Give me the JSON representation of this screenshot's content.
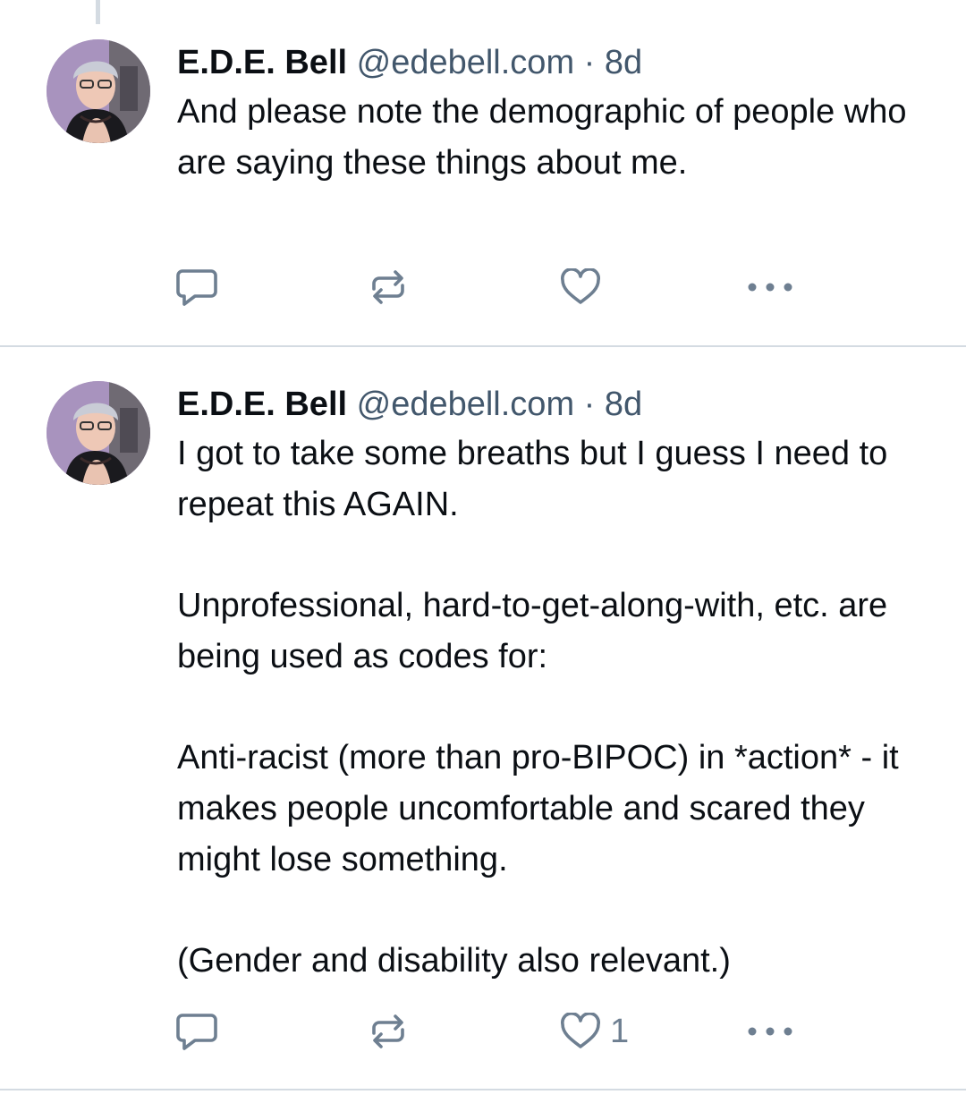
{
  "posts": [
    {
      "author_name": "E.D.E. Bell",
      "handle": "@edebell.com",
      "separator": "·",
      "time": "8d",
      "paragraphs": [
        "And please note the demographic of people who are saying these things about me."
      ],
      "like_count": ""
    },
    {
      "author_name": "E.D.E. Bell",
      "handle": "@edebell.com",
      "separator": "·",
      "time": "8d",
      "paragraphs": [
        "I got to take some breaths but I guess I need to repeat this AGAIN.",
        "Unprofessional, hard-to-get-along-with, etc. are being used as codes for:",
        "Anti-racist (more than pro-BIPOC) in *action* - it makes people uncomfortable and scared they might lose something.",
        "(Gender and disability also relevant.)"
      ],
      "like_count": "1"
    }
  ],
  "icons": {
    "reply": "reply-icon",
    "repost": "repost-icon",
    "like": "heart-icon",
    "more": "more-options-icon"
  },
  "colors": {
    "text": "#0b0f14",
    "meta": "#42576c",
    "icon": "#6e7f91",
    "divider": "#d4dbe2"
  }
}
